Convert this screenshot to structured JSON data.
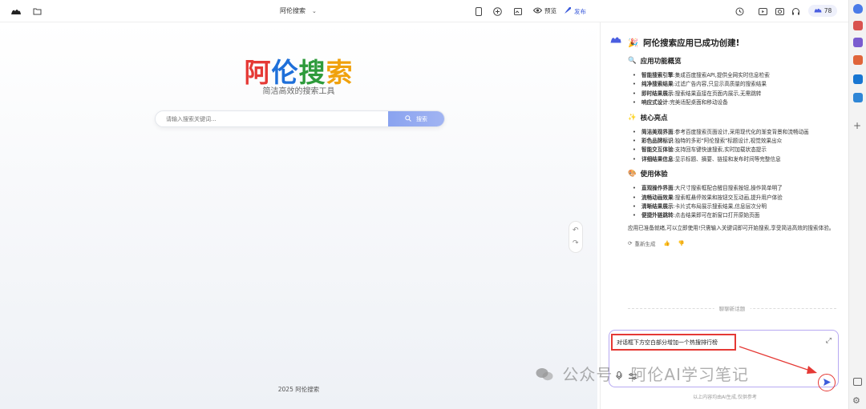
{
  "topbar": {
    "project_title": "阿伦搜索",
    "preview_label": "预览",
    "publish_label": "发布",
    "credits": "78"
  },
  "preview": {
    "logo_chars": [
      {
        "char": "阿",
        "color": "#e53935"
      },
      {
        "char": "伦",
        "color": "#1e6fd9"
      },
      {
        "char": "搜",
        "color": "#2e9b3b"
      },
      {
        "char": "索",
        "color": "#f0a10c"
      }
    ],
    "subtitle": "简洁高效的搜索工具",
    "search_placeholder": "请输入搜索关键词...",
    "search_button": "搜索",
    "footer": "2025 阿伦搜索"
  },
  "chat": {
    "heading": "阿伦搜索应用已成功创建!",
    "sections": [
      {
        "title": "应用功能概览",
        "icon": "magnifier-emoji",
        "items": [
          {
            "label": "智能搜索引擎",
            "text": "集成百度搜索API,提供全网实时信息检索"
          },
          {
            "label": "纯净搜索结果",
            "text": "过滤广告内容,只显示高质量的搜索结果"
          },
          {
            "label": "即时结果展示",
            "text": "搜索结果直接在页面内展示,无需跳转"
          },
          {
            "label": "响应式设计",
            "text": "完美适配桌面和移动设备"
          }
        ]
      },
      {
        "title": "核心亮点",
        "icon": "sparkles-emoji",
        "items": [
          {
            "label": "简洁美观界面",
            "text": "参考百度搜索页面设计,采用现代化的渐变背景和流畅动画"
          },
          {
            "label": "彩色品牌标识",
            "text": "独特的多彩\"阿伦搜索\"标题设计,视觉效果出众"
          },
          {
            "label": "智能交互体验",
            "text": "支持回车键快速搜索,实时加载状态提示"
          },
          {
            "label": "详细结果信息",
            "text": "显示标题、摘要、链接和发布时间等完整信息"
          }
        ]
      },
      {
        "title": "使用体验",
        "icon": "palette-emoji",
        "items": [
          {
            "label": "直观操作界面",
            "text": "大尺寸搜索框配合醒目搜索按钮,操作简单明了"
          },
          {
            "label": "流畅动画效果",
            "text": "搜索框悬停效果和按钮交互动画,提升用户体验"
          },
          {
            "label": "清晰结果展示",
            "text": "卡片式布局展示搜索结果,信息层次分明"
          },
          {
            "label": "便捷外链跳转",
            "text": "点击结果即可在新窗口打开原始页面"
          }
        ]
      }
    ],
    "closing": "应用已准备就绪,可以立即使用!只需输入关键词即可开始搜索,享受简洁高效的搜索体验。",
    "regenerate_label": "重新生成",
    "divider_label": "聊聊新话题",
    "input_text": "对话框下方空白部分增加一个热搜排行榜",
    "disclaimer": "以上内容均由AI生成,仅供参考"
  },
  "watermark": "公众号 · 阿伦AI学习笔记",
  "colors": {
    "accent": "#3b5bdb",
    "highlight_border": "#e53935",
    "input_border": "#b7a9f2"
  }
}
